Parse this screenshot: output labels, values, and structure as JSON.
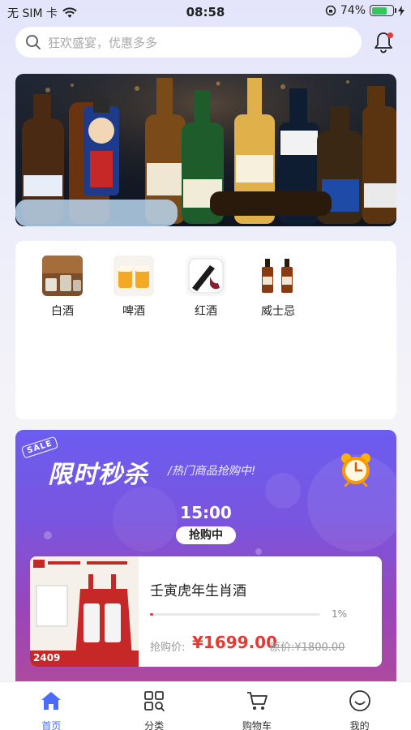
{
  "status_bar": {
    "carrier": "无 SIM 卡",
    "time": "08:58",
    "battery": "74%",
    "battery_level": 0.74
  },
  "search": {
    "placeholder": "狂欢盛宴，优惠多多"
  },
  "categories": [
    {
      "label": "白酒",
      "icon": "baijiu-icon"
    },
    {
      "label": "啤酒",
      "icon": "beer-icon"
    },
    {
      "label": "红酒",
      "icon": "wine-icon"
    },
    {
      "label": "威士忌",
      "icon": "whisky-icon"
    }
  ],
  "flash_sale": {
    "tag": "SALE",
    "title": "限时秒杀",
    "subtitle": "/热门商品抢购中!",
    "time": "15:00",
    "status": "抢购中",
    "product": {
      "name": "壬寅虎年生肖酒",
      "progress": "1%",
      "progress_value": 0.01,
      "price_label": "抢购价:",
      "price": "¥1699.00",
      "original_price": "原价:¥1800.00",
      "image_caption": "2409"
    }
  },
  "tabs": [
    {
      "label": "首页",
      "icon": "home-icon",
      "active": true
    },
    {
      "label": "分类",
      "icon": "category-icon",
      "active": false
    },
    {
      "label": "购物车",
      "icon": "cart-icon",
      "active": false
    },
    {
      "label": "我的",
      "icon": "profile-icon",
      "active": false
    }
  ],
  "colors": {
    "accent": "#4a6cf7",
    "price_red": "#e53935",
    "flash_purple": "#6b5cf0"
  }
}
